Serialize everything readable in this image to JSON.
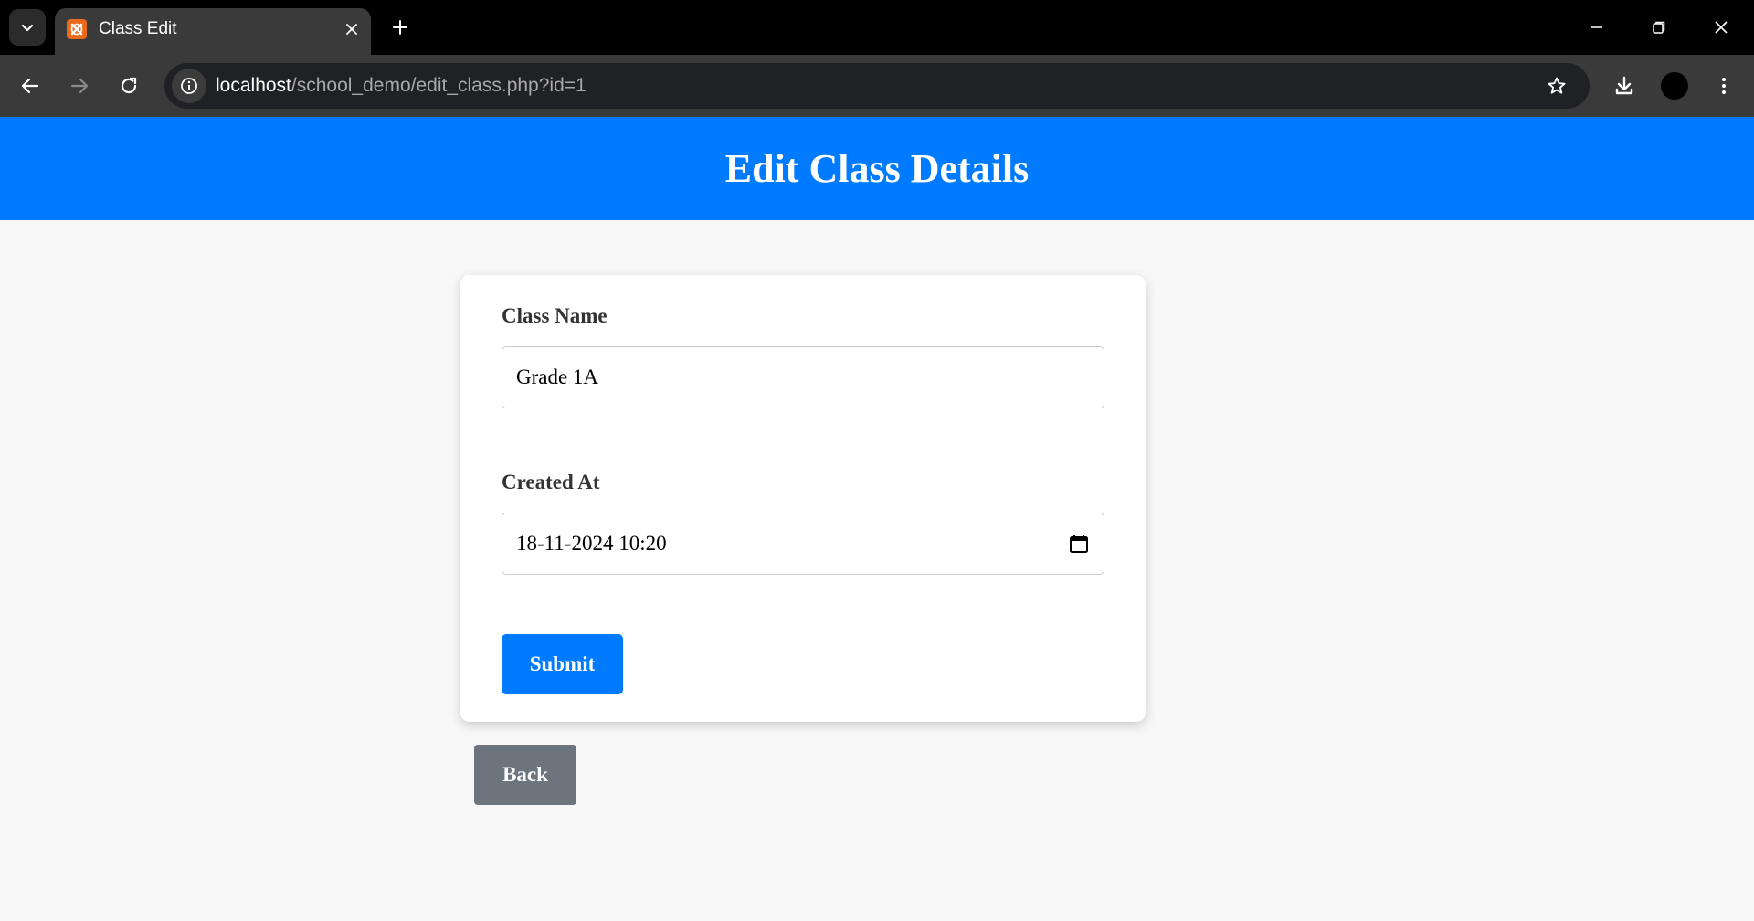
{
  "browser": {
    "tab_title": "Class Edit",
    "url_host": "localhost",
    "url_path": "/school_demo/edit_class.php?id=1"
  },
  "page": {
    "title": "Edit Class Details"
  },
  "form": {
    "class_name_label": "Class Name",
    "class_name_value": "Grade 1A",
    "created_at_label": "Created At",
    "created_at_value": "18-11-2024 10:20",
    "submit_label": "Submit"
  },
  "back_label": "Back",
  "colors": {
    "header_bg": "#007bff",
    "primary_button": "#007bff",
    "secondary_button": "#6c757d",
    "page_bg": "#f8f8f8"
  },
  "icons": [
    "chevron-down-icon",
    "xampp-favicon-icon",
    "close-icon",
    "plus-icon",
    "minimize-icon",
    "restore-icon",
    "window-close-icon",
    "back-arrow-icon",
    "forward-arrow-icon",
    "reload-icon",
    "site-info-icon",
    "star-icon",
    "download-icon",
    "more-vert-icon",
    "calendar-icon"
  ]
}
